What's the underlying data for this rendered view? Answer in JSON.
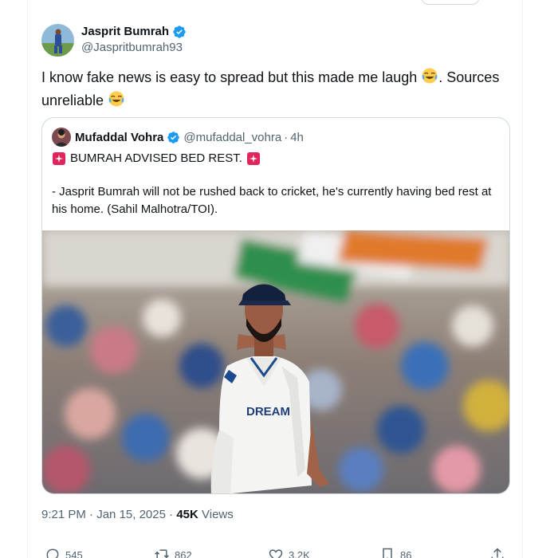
{
  "author": {
    "display_name": "Jasprit Bumrah",
    "handle": "@Jaspritbumrah93",
    "verified": true
  },
  "tweet": {
    "text_part1": "I know fake news is easy to spread but this made me laugh",
    "text_part2": ".  Sources unreliable",
    "emoji": "tears-of-joy-emoji"
  },
  "quoted": {
    "display_name": "Mufaddal Vohra",
    "handle": "@mufaddal_vohra",
    "separator": "·",
    "time": "4h",
    "headline": "BUMRAH ADVISED BED REST.",
    "body": "- Jasprit Bumrah will not be rushed back to cricket, he's currently having bed rest at his home. (Sahil Malhotra/TOI).",
    "media_jersey_text": "DREAM"
  },
  "meta": {
    "time": "9:21 PM",
    "date": "Jan 15, 2025",
    "separator": "·",
    "views_count": "45K",
    "views_label": "Views"
  },
  "actions": {
    "replies": "545",
    "reposts": "862",
    "likes": "3.2K",
    "bookmarks": "86"
  },
  "colors": {
    "verified": "#1d9bf0",
    "secondary_text": "#536471",
    "border": "#cfd9de",
    "siren_red": "#e0245e"
  }
}
